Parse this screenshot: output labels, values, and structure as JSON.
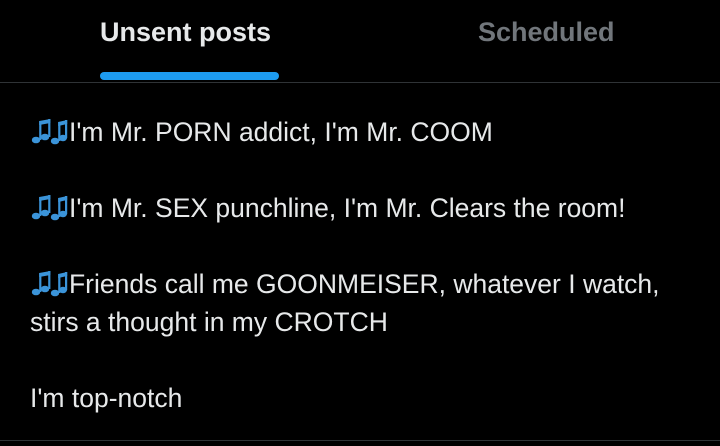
{
  "tabs": {
    "unsent": "Unsent posts",
    "scheduled": "Scheduled"
  },
  "colors": {
    "background": "#000000",
    "active_tab_indicator": "#1d9bf0",
    "music_icon": "#3b94d9",
    "text_primary": "#e7e9ea",
    "text_secondary": "#71767b"
  },
  "icons": {
    "music": "musical-notes-icon"
  },
  "draft": {
    "line1": "I'm Mr. PORN addict, I'm Mr. COOM",
    "line2": "I'm Mr. SEX punchline, I'm Mr. Clears the room!",
    "line3": "Friends call me GOONMEISER, whatever I watch, stirs a thought in my CROTCH",
    "line4": "I'm top-notch"
  }
}
